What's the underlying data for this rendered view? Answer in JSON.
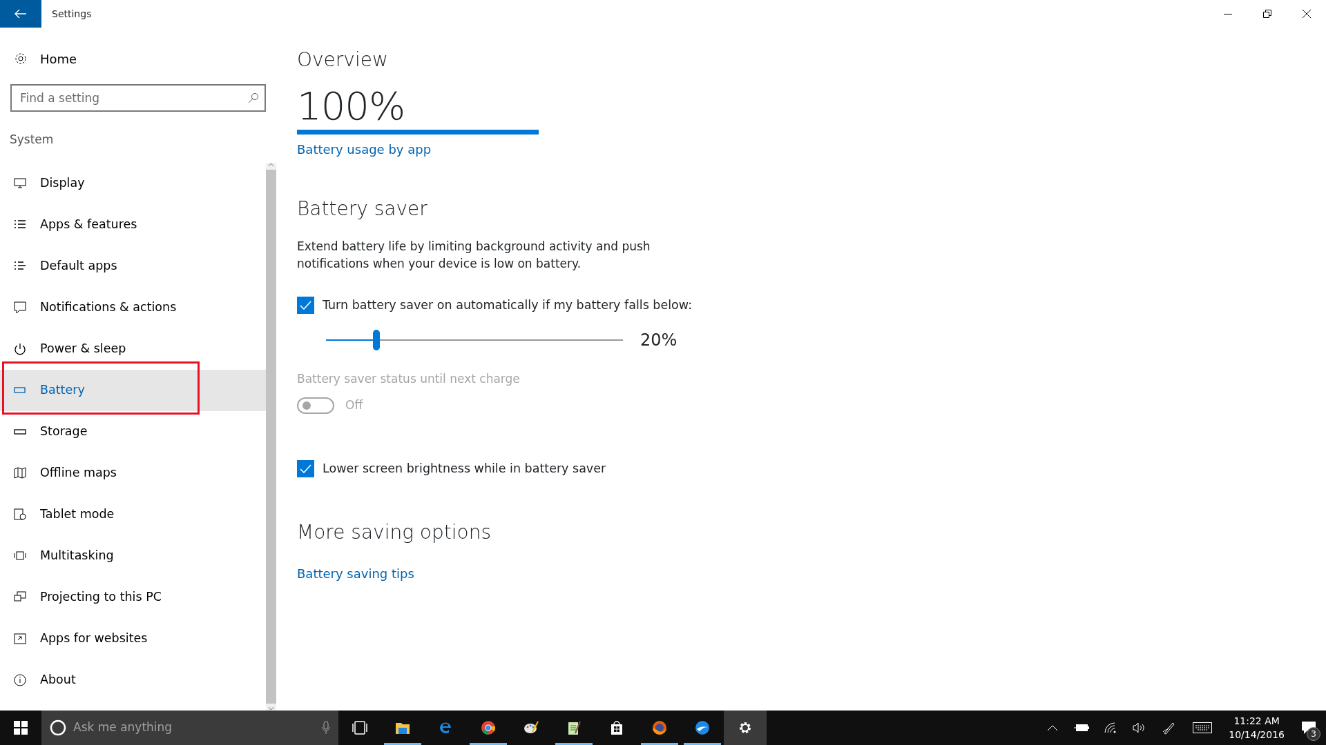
{
  "window": {
    "title": "Settings"
  },
  "sidebar": {
    "home": "Home",
    "search": {
      "placeholder": "Find a setting"
    },
    "section": "System",
    "items": [
      {
        "label": "Display",
        "selected": false,
        "outlined": false
      },
      {
        "label": "Apps & features",
        "selected": false,
        "outlined": false
      },
      {
        "label": "Default apps",
        "selected": false,
        "outlined": false
      },
      {
        "label": "Notifications & actions",
        "selected": false,
        "outlined": false
      },
      {
        "label": "Power & sleep",
        "selected": false,
        "outlined": false
      },
      {
        "label": "Battery",
        "selected": true,
        "outlined": true
      },
      {
        "label": "Storage",
        "selected": false,
        "outlined": false
      },
      {
        "label": "Offline maps",
        "selected": false,
        "outlined": false
      },
      {
        "label": "Tablet mode",
        "selected": false,
        "outlined": false
      },
      {
        "label": "Multitasking",
        "selected": false,
        "outlined": false
      },
      {
        "label": "Projecting to this PC",
        "selected": false,
        "outlined": false
      },
      {
        "label": "Apps for websites",
        "selected": false,
        "outlined": false
      },
      {
        "label": "About",
        "selected": false,
        "outlined": false
      }
    ]
  },
  "overview": {
    "heading": "Overview",
    "percent": "100%",
    "level": 1.0,
    "link": "Battery usage by app"
  },
  "battery_saver": {
    "heading": "Battery saver",
    "description": "Extend battery life by limiting background activity and push notifications when your device is low on battery.",
    "auto": {
      "label": "Turn battery saver on automatically if my battery falls below:",
      "checked": true
    },
    "threshold": {
      "level": 0.17,
      "reading": "20%"
    },
    "status": {
      "label": "Battery saver status until next charge",
      "on": false,
      "disabled": true,
      "state_text": "Off"
    },
    "brightness": {
      "label": "Lower screen brightness while in battery saver",
      "checked": true
    }
  },
  "more": {
    "heading": "More saving options",
    "link": "Battery saving tips"
  },
  "taskbar": {
    "search_placeholder": "Ask me anything",
    "apps": [
      {
        "kind": "taskview",
        "running": false,
        "active": false
      },
      {
        "kind": "explorer",
        "running": true,
        "active": false
      },
      {
        "kind": "edge",
        "running": false,
        "active": false
      },
      {
        "kind": "chrome",
        "running": true,
        "active": false
      },
      {
        "kind": "paint",
        "running": false,
        "active": false
      },
      {
        "kind": "notepad",
        "running": true,
        "active": false
      },
      {
        "kind": "store",
        "running": false,
        "active": false
      },
      {
        "kind": "firefox",
        "running": true,
        "active": false
      },
      {
        "kind": "bird",
        "running": true,
        "active": false
      },
      {
        "kind": "settings",
        "running": false,
        "active": true
      }
    ],
    "time": "11:22 AM",
    "date": "10/14/2016",
    "notifications": "3"
  }
}
